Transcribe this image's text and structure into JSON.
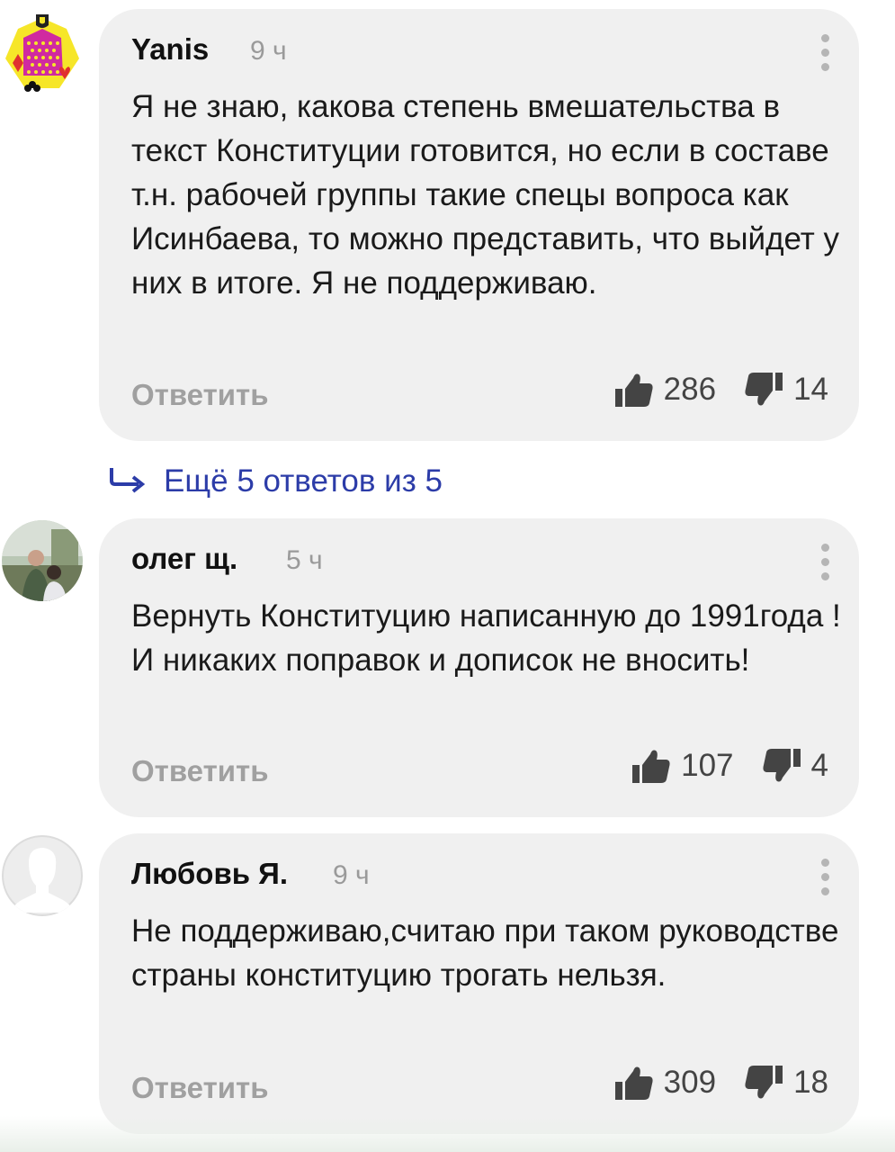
{
  "comments": [
    {
      "author": "Yanis",
      "time": "9 ч",
      "text": "Я не знаю, какова степень вмешательства в текст Конституции готовится, но если в составе т.н. рабочей группы такие спецы вопроса как Исинбаева, то можно представить, что выйдет у них в итоге. Я не поддерживаю.",
      "reply_label": "Ответить",
      "likes": "286",
      "dislikes": "14",
      "avatar_icon": "jester-card-avatar"
    },
    {
      "author": "олег щ.",
      "time": "5 ч",
      "text": "Вернуть Конституцию написанную до 1991года ! И никаких поправок и дописок не вносить!",
      "reply_label": "Ответить",
      "likes": "107",
      "dislikes": "4",
      "avatar_icon": "photo-avatar"
    },
    {
      "author": "Любовь Я.",
      "time": "9 ч",
      "text": "Не поддерживаю,считаю при таком руководстве страны конституцию трогать нельзя.",
      "reply_label": "Ответить",
      "likes": "309",
      "dislikes": "18",
      "avatar_icon": "default-user-avatar"
    }
  ],
  "thread": {
    "more_replies_label": "Ещё 5 ответов из 5",
    "icon": "reply-arrow-icon"
  },
  "colors": {
    "bubble": "#f0f0f0",
    "link": "#2c3ca8",
    "muted": "#a0a0a0"
  }
}
